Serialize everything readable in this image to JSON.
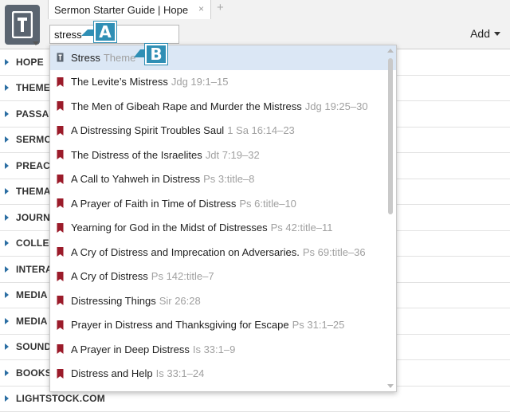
{
  "tab": {
    "title": "Sermon Starter Guide | Hope",
    "close_glyph": "×",
    "add_glyph": "+"
  },
  "search": {
    "value": "stress"
  },
  "toolbar": {
    "add_label": "Add"
  },
  "callouts": {
    "a": "A",
    "b": "B"
  },
  "sections": [
    "HOPE",
    "THEME",
    "PASSAGES",
    "SERMONS",
    "PREACHING",
    "THEMATIC",
    "JOURNALS",
    "COLLECTIONS",
    "INTERACTIVE",
    "MEDIA LIBRARY",
    "MEDIA COLLECTIONS",
    "SOUND",
    "BOOKSTORE",
    "LIGHTSTOCK.COM"
  ],
  "dropdown": {
    "items": [
      {
        "title": "Stress",
        "ref": "Theme",
        "icon": "theme-icon",
        "selected": true
      },
      {
        "title": "The Levite’s Mistress",
        "ref": "Jdg 19:1–15",
        "icon": "bookmark-icon"
      },
      {
        "title": "The Men of Gibeah Rape and Murder the Mistress",
        "ref": "Jdg 19:25–30",
        "icon": "bookmark-icon"
      },
      {
        "title": "A Distressing Spirit Troubles Saul",
        "ref": "1 Sa 16:14–23",
        "icon": "bookmark-icon"
      },
      {
        "title": "The Distress of the Israelites",
        "ref": "Jdt 7:19–32",
        "icon": "bookmark-icon"
      },
      {
        "title": "A Call to Yahweh in Distress",
        "ref": "Ps 3:title–8",
        "icon": "bookmark-icon"
      },
      {
        "title": "A Prayer of Faith in Time of Distress",
        "ref": "Ps 6:title–10",
        "icon": "bookmark-icon"
      },
      {
        "title": "Yearning for God in the Midst of Distresses",
        "ref": "Ps 42:title–11",
        "icon": "bookmark-icon"
      },
      {
        "title": "A Cry of Distress and Imprecation on Adversaries.",
        "ref": "Ps 69:title–36",
        "icon": "bookmark-icon"
      },
      {
        "title": "A Cry of Distress",
        "ref": "Ps 142:title–7",
        "icon": "bookmark-icon"
      },
      {
        "title": "Distressing Things",
        "ref": "Sir 26:28",
        "icon": "bookmark-icon"
      },
      {
        "title": "Prayer in Distress and Thanksgiving for Escape",
        "ref": "Ps 31:1–25",
        "icon": "bookmark-icon"
      },
      {
        "title": "A Prayer in Deep Distress",
        "ref": "Is 33:1–9",
        "icon": "bookmark-icon"
      },
      {
        "title": "Distress and Help",
        "ref": "Is 33:1–24",
        "icon": "bookmark-icon"
      }
    ]
  },
  "colors": {
    "accent": "#2f8fb5",
    "bookmark": "#9b1b2a",
    "selection": "#dbe7f5",
    "ref_text": "#a0a0a0"
  }
}
